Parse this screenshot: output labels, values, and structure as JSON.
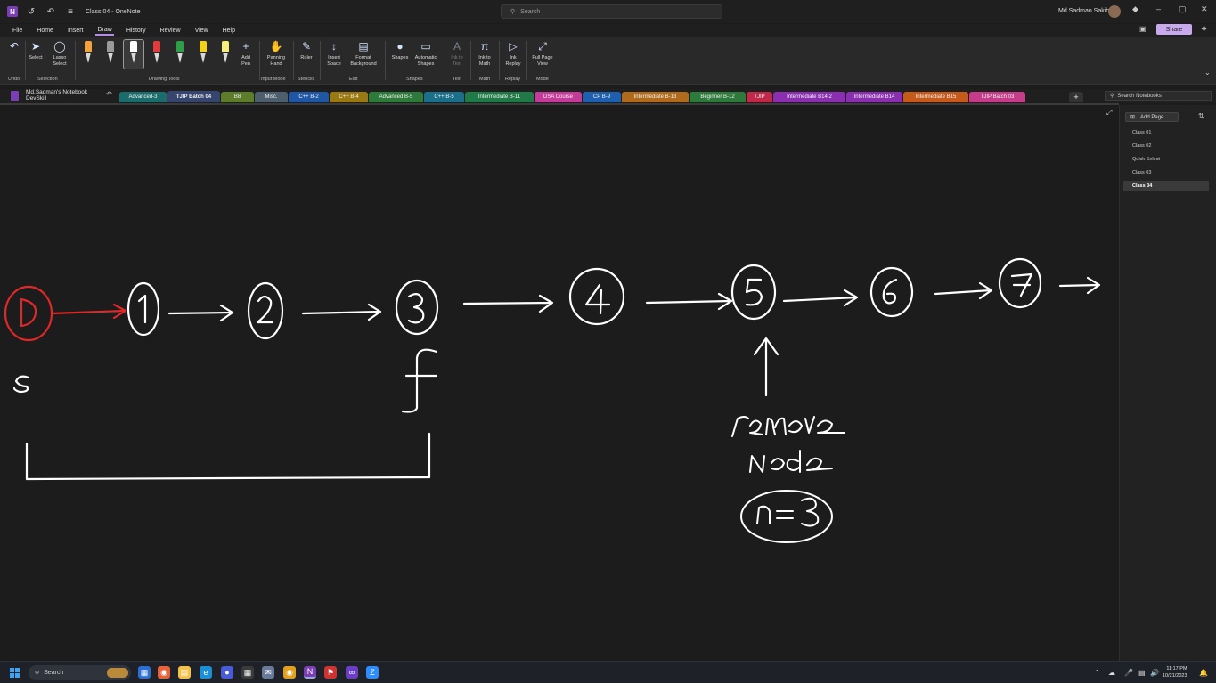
{
  "window": {
    "title": "Class 04 - OneNote",
    "search_placeholder": "Search",
    "user_name": "Md Sadman Sakib"
  },
  "menu": {
    "items": [
      "File",
      "Home",
      "Insert",
      "Draw",
      "History",
      "Review",
      "View",
      "Help"
    ],
    "active": "Draw",
    "share_label": "Share"
  },
  "ribbon": {
    "buttons": {
      "select": "Select",
      "lasso": "Lasso Select",
      "add_pen": "Add Pen",
      "panning": "Panning Hand",
      "ruler": "Ruler",
      "insert_space": "Insert Space",
      "format_bg": "Format Background",
      "shapes": "Shapes",
      "auto_shapes": "Automatic Shapes",
      "ink_to_text": "Ink to Text",
      "ink_to_math": "Ink to Math",
      "ink_replay": "Ink Replay",
      "full_page": "Full Page View"
    },
    "groups": {
      "undo": "Undo",
      "selection": "Selection",
      "drawing_tools": "Drawing Tools",
      "input_mode": "Input Mode",
      "stencils": "Stencils",
      "edit": "Edit",
      "shapes": "Shapes",
      "text": "Text",
      "math": "Math",
      "replay": "Replay",
      "mode": "Mode"
    },
    "pen_colors": [
      "#f4a23a",
      "#9a9a9a",
      "#ffffff",
      "#e23b3b",
      "#2e9e4a",
      "#f2d21e",
      "#f5ee7a"
    ]
  },
  "notebook": {
    "name": "Md.Sadman's Notebook",
    "section_group": "DevSkill"
  },
  "sections": [
    {
      "label": "Advanced-3",
      "color": "#1b6d6d"
    },
    {
      "label": "TJIP Batch 04",
      "color": "#36456e",
      "active": true
    },
    {
      "label": "B8",
      "color": "#5d7d2a"
    },
    {
      "label": "Misc.",
      "color": "#4d5f6e"
    },
    {
      "label": "C++ B-2",
      "color": "#1f57a6"
    },
    {
      "label": "C++ B-4",
      "color": "#9a7a10"
    },
    {
      "label": "Advanced B-5",
      "color": "#2d7a3a"
    },
    {
      "label": "C++ B-5",
      "color": "#1a6f8a"
    },
    {
      "label": "Intermediate B-11",
      "color": "#1f7a48"
    },
    {
      "label": "DSA Course",
      "color": "#c43c9a"
    },
    {
      "label": "CP B-9",
      "color": "#1f5fb0"
    },
    {
      "label": "Intermediate B-13",
      "color": "#b06a1c"
    },
    {
      "label": "Beginner B-12",
      "color": "#2d7a3a"
    },
    {
      "label": "TJIP",
      "color": "#c2284a"
    },
    {
      "label": "Intermediate B14.2",
      "color": "#8a2fb0"
    },
    {
      "label": "Intermediate B14",
      "color": "#8a2fb0"
    },
    {
      "label": "Intermediate B15",
      "color": "#c65a1a"
    },
    {
      "label": "TJIP Batch 03",
      "color": "#c43c8a"
    }
  ],
  "search_notebooks": "Search Notebooks",
  "pages": {
    "add_label": "Add Page",
    "items": [
      "Class 01",
      "Class 02",
      "Quick Select",
      "Class 03",
      "Class 04"
    ],
    "active": "Class 04"
  },
  "ink": {
    "nodes": [
      "0",
      "1",
      "2",
      "3",
      "4",
      "5",
      "6",
      "7"
    ],
    "head_color": "#e02828",
    "ink_color": "#ffffff",
    "slow_label": "s",
    "fast_label": "f",
    "annotation_line1": "remove",
    "annotation_line2": "node",
    "annotation_value": "n=3"
  },
  "taskbar": {
    "search_label": "Search",
    "time": "11:17 PM",
    "date": "10/21/2023"
  }
}
